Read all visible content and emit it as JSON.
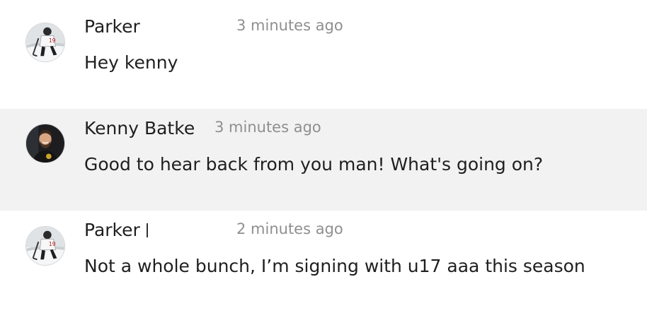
{
  "messages": [
    {
      "author": "Parker",
      "time": "3 minutes ago",
      "text": "Hey kenny",
      "avatar_icon": "hockey-player-avatar"
    },
    {
      "author": "Kenny Batke",
      "time": "3 minutes ago",
      "text": "Good to hear back from you man! What's going on?",
      "avatar_icon": "bearded-man-avatar"
    },
    {
      "author": "Parker",
      "time": "2 minutes ago",
      "text": "Not a whole bunch, I’m signing with u17 aaa this season",
      "avatar_icon": "hockey-player-avatar"
    }
  ],
  "colors": {
    "background": "#ffffff",
    "highlight_row": "#f2f2f2",
    "timestamp": "#8f8f8f",
    "text": "#1f1f1f"
  }
}
